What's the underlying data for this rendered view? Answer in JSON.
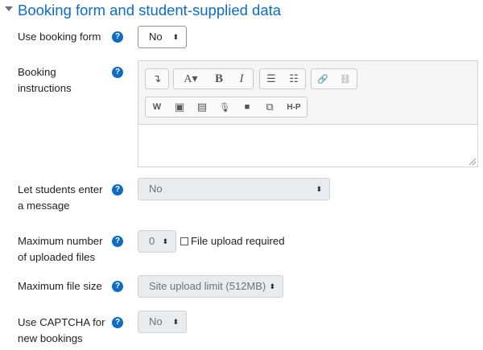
{
  "section": {
    "title": "Booking form and student-supplied data"
  },
  "fields": {
    "use_booking_form": {
      "label": "Use booking form",
      "value": "No"
    },
    "booking_instructions": {
      "label_line1": "Booking",
      "label_line2": "instructions"
    },
    "let_students_message": {
      "label_line1": "Let students enter",
      "label_line2": "a message",
      "value": "No"
    },
    "max_uploaded_files": {
      "label_line1": "Maximum number",
      "label_line2": "of uploaded files",
      "value": "0",
      "checkbox_label": "File upload required",
      "checked": false
    },
    "max_file_size": {
      "label": "Maximum file size",
      "value": "Site upload limit (512MB)"
    },
    "use_captcha": {
      "label_line1": "Use CAPTCHA for",
      "label_line2": "new bookings",
      "value": "No"
    }
  },
  "help": {
    "glyph": "?"
  },
  "editor": {
    "toolbar_row1": [
      {
        "name": "collapse-toolbar-icon",
        "glyph": "↴"
      },
      {
        "name": "font-color-icon",
        "glyph": "A▾"
      },
      {
        "name": "bold-icon",
        "glyph": "B"
      },
      {
        "name": "italic-icon",
        "glyph": "I"
      },
      {
        "name": "unordered-list-icon",
        "glyph": "☰"
      },
      {
        "name": "ordered-list-icon",
        "glyph": "☷"
      },
      {
        "name": "link-icon",
        "glyph": "🔗"
      },
      {
        "name": "unlink-icon",
        "glyph": "⛓"
      }
    ],
    "toolbar_row2": [
      {
        "name": "word-import-icon",
        "glyph": "W"
      },
      {
        "name": "image-icon",
        "glyph": "▣"
      },
      {
        "name": "media-icon",
        "glyph": "▤"
      },
      {
        "name": "record-audio-icon",
        "glyph": "🎙"
      },
      {
        "name": "record-video-icon",
        "glyph": "■"
      },
      {
        "name": "manage-files-icon",
        "glyph": "⧉"
      },
      {
        "name": "h5p-icon",
        "glyph": "H-P"
      }
    ]
  },
  "colors": {
    "accent": "#0f6cbf",
    "text": "#1d2125",
    "disabled_bg": "#e9ecef"
  }
}
